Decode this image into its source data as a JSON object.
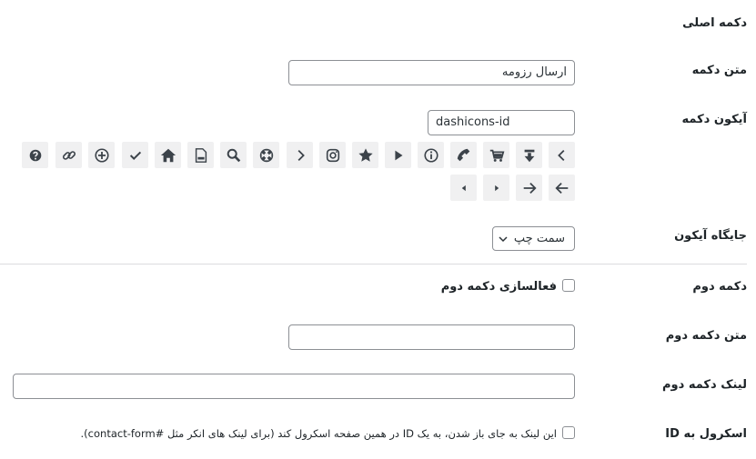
{
  "primary_button": {
    "section_title": "دکمه اصلی",
    "text_label": "متن دکمه",
    "text_value": "ارسال رزومه",
    "icon_label": "آیکون دکمه",
    "icon_value": "dashicons-id",
    "icon_options": [
      "arrow-left-icon",
      "arrow-right-alt-icon",
      "small-arrow-right-icon",
      "small-arrow-left-icon",
      "chevron-left-icon",
      "download-icon",
      "cart-icon",
      "phone-icon",
      "info-icon",
      "play-icon",
      "star-icon",
      "instagram-icon",
      "chevron-right-icon",
      "sos-icon",
      "search-icon",
      "pdf-icon",
      "home-icon",
      "check-icon",
      "plus-circle-icon",
      "link-icon",
      "help-icon"
    ],
    "position_label": "جایگاه آیکون",
    "position_value": "سمت چپ"
  },
  "secondary_button": {
    "section_title": "دکمه دوم",
    "enable_label": "فعالسازی دکمه دوم",
    "text_label": "متن دکمه دوم",
    "text_value": "",
    "link_label": "لینک دکمه دوم",
    "link_value": "",
    "scroll_label": "اسکرول به ID",
    "scroll_description": "این لینک به جای باز شدن، به یک ID در همین صفحه اسکرول کند (برای لینک های انکر مثل #contact-form)."
  }
}
